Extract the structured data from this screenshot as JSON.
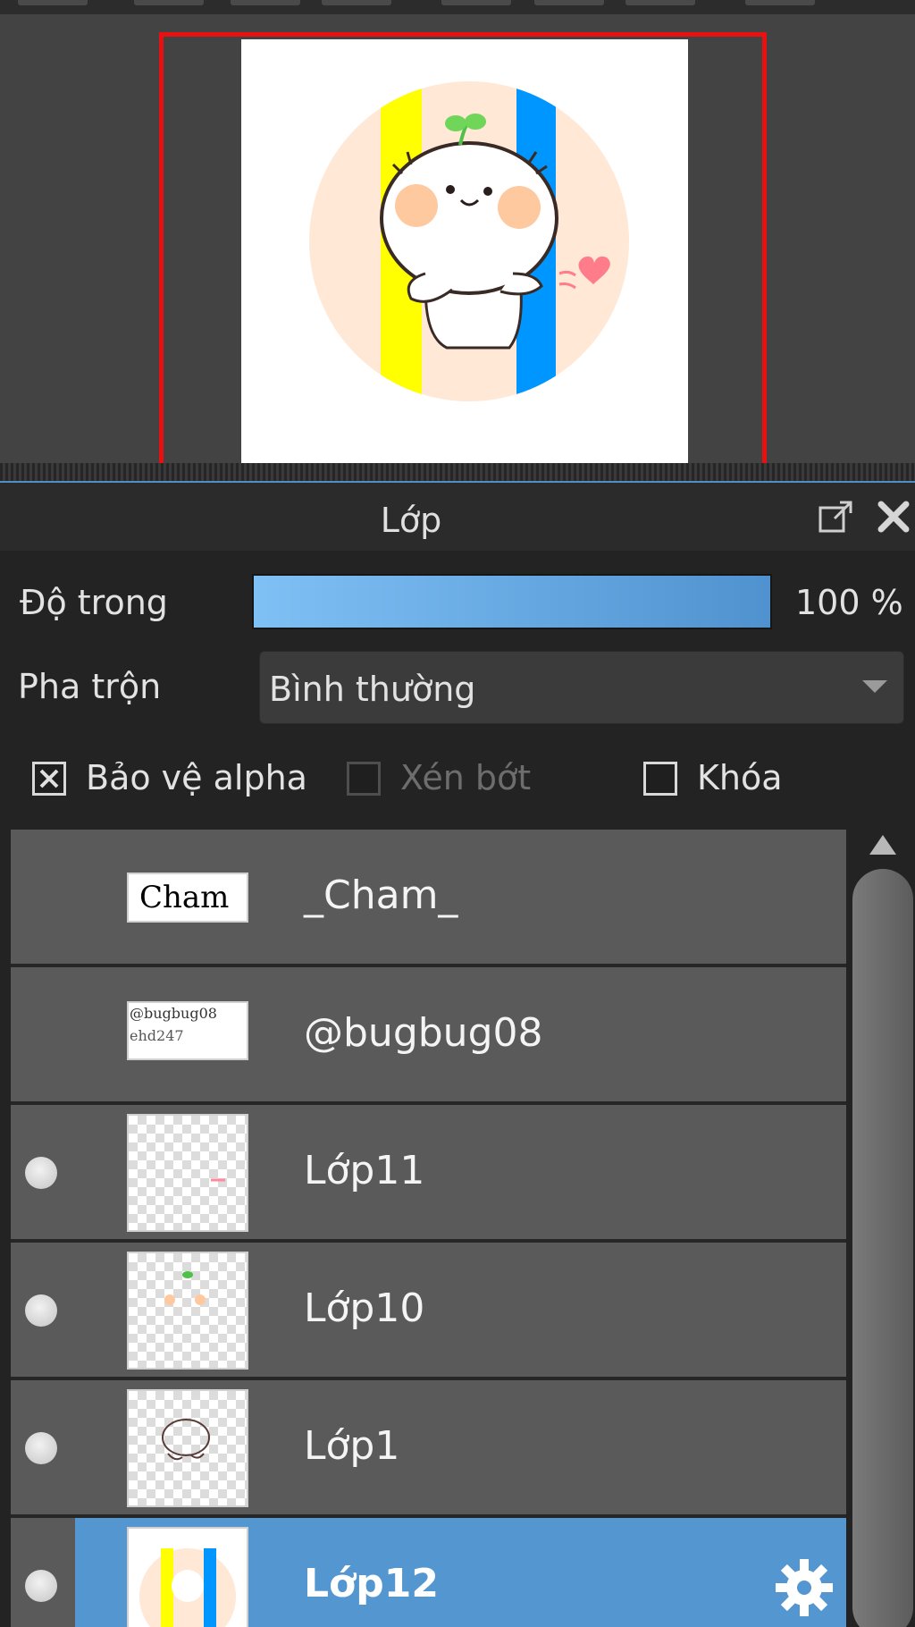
{
  "panel": {
    "title": "Lớp",
    "float_icon": "float-window-icon",
    "close_icon": "close-icon"
  },
  "opacity": {
    "label": "Độ trong",
    "value": 100,
    "value_text": "100 %"
  },
  "blend": {
    "label": "Pha trộn",
    "selected": "Bình thường"
  },
  "checkboxes": {
    "protect_alpha": {
      "label": "Bảo vệ alpha",
      "checked": true,
      "enabled": true
    },
    "clipping": {
      "label": "Xén bớt",
      "checked": false,
      "enabled": false
    },
    "lock": {
      "label": "Khóa",
      "checked": false,
      "enabled": true
    }
  },
  "layers": [
    {
      "name": "_Cham_",
      "thumb_text": "Cham",
      "visible_dot": false,
      "selected": false
    },
    {
      "name": "@bugbug08",
      "thumb_text": "@bugbug08",
      "thumb_text_2": "ehd247",
      "visible_dot": false,
      "selected": false
    },
    {
      "name": "Lớp11",
      "visible_dot": true,
      "selected": false
    },
    {
      "name": "Lớp10",
      "visible_dot": true,
      "selected": false
    },
    {
      "name": "Lớp1",
      "visible_dot": true,
      "selected": false
    },
    {
      "name": "Lớp12",
      "visible_dot": true,
      "selected": true,
      "settings_icon": "gear-icon"
    }
  ],
  "colors": {
    "selected_row": "#5497d0",
    "viewport_border": "#e81010",
    "stripe_yellow": "#ffff00",
    "stripe_blue": "#0096ff",
    "circle_peach": "#ffe8d6"
  }
}
